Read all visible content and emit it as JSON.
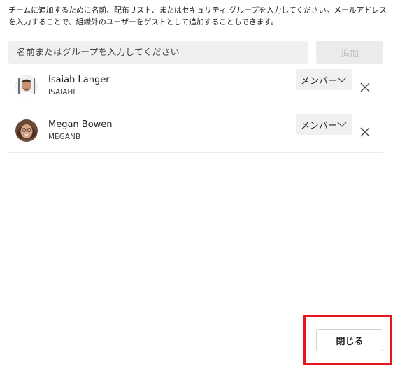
{
  "instructions": "チームに追加するために名前、配布リスト、またはセキュリティ グループを入力してください。メールアドレスを入力することで、組織外のユーザーをゲストとして追加することもできます。",
  "search": {
    "placeholder": "名前またはグループを入力してください",
    "value": ""
  },
  "add_button_label": "追加",
  "members": [
    {
      "name": "Isaiah Langer",
      "id": "ISAIAHL",
      "role": "メンバー",
      "avatar": "isaiah-avatar"
    },
    {
      "name": "Megan Bowen",
      "id": "MEGANB",
      "role": "メンバー",
      "avatar": "megan-avatar"
    }
  ],
  "close_button_label": "閉じる",
  "colors": {
    "highlight": "#e8141e",
    "input_bg": "#f0f0f0",
    "disabled_text": "#bdbdbd"
  }
}
